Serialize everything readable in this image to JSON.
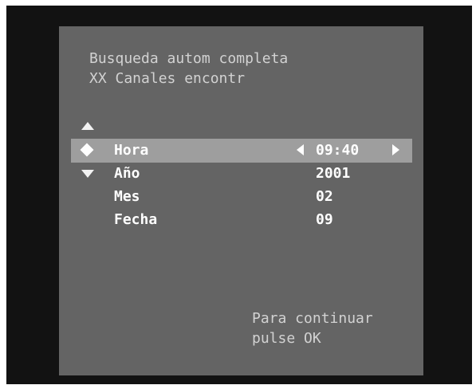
{
  "header": {
    "line1": "Busqueda autom completa",
    "line2": "XX Canales encontr"
  },
  "menu": {
    "selected_index": 0,
    "rows": [
      {
        "label": "Hora",
        "value": "09:40"
      },
      {
        "label": "Año",
        "value": "2001"
      },
      {
        "label": "Mes",
        "value": "02"
      },
      {
        "label": "Fecha",
        "value": "09"
      }
    ]
  },
  "icons": {
    "scroll_up": "triangle-up-icon",
    "scroll_down": "triangle-down-icon",
    "cursor": "diamond-icon",
    "value_decrease": "triangle-left-icon",
    "value_increase": "triangle-right-icon"
  },
  "footer": {
    "line1": "Para continuar",
    "line2": "pulse OK"
  },
  "colors": {
    "frame": "#121212",
    "panel": "#646464",
    "highlight": "#9e9e9e",
    "text_primary": "#ffffff",
    "text_secondary": "#d2d2d2"
  }
}
